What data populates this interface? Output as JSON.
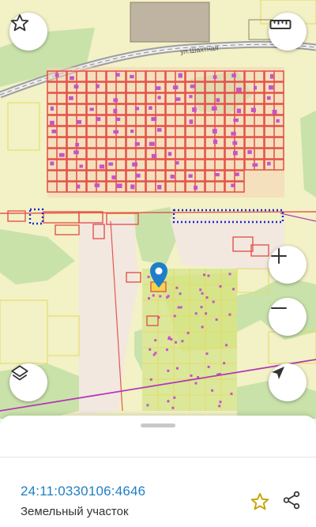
{
  "map": {
    "street_label": "ул.Шахтная",
    "colors": {
      "residential": "#f3f1c6",
      "green": "#c8e2a8",
      "road": "#b5b5b5",
      "parcel": "#e4554c",
      "building": "#c653c8",
      "zone": "#e6e35c",
      "selection": "#1a29c9",
      "boundary": "#b23bb5"
    },
    "marker": {
      "icon": "map-pin-icon",
      "color": "#1e7fc8"
    }
  },
  "controls": {
    "favorite": "star-outline-icon",
    "ruler": "ruler-icon",
    "zoom_in": "plus-icon",
    "zoom_out": "minus-icon",
    "layers": "layers-icon",
    "locate": "navigation-arrow-icon"
  },
  "sheet": {
    "cadastral_number": "24:11:0330106:4646",
    "property_type": "Земельный участок",
    "favorite_icon": "star-outline-icon",
    "share_icon": "share-icon"
  }
}
